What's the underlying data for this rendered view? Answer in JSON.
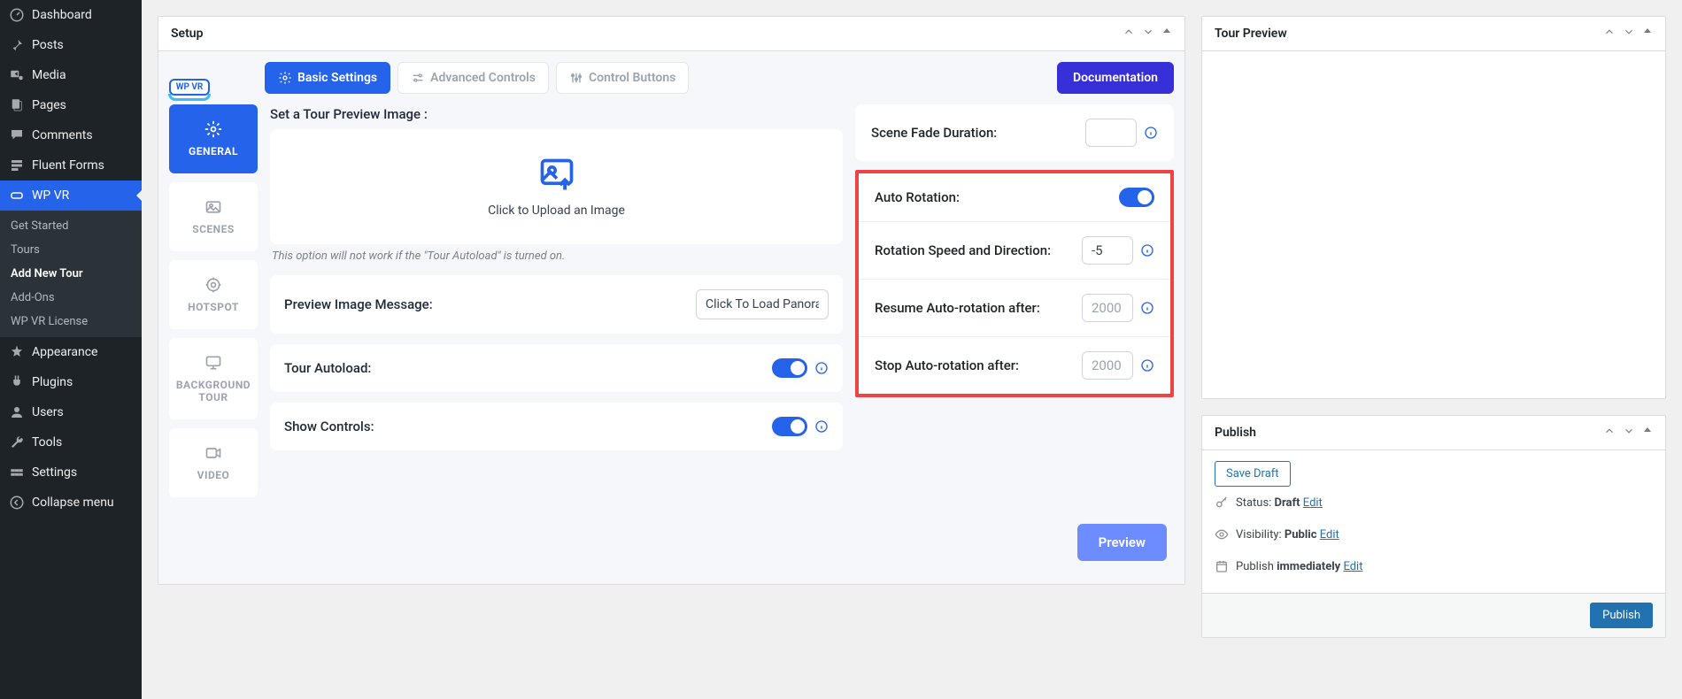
{
  "sidebar": {
    "items": [
      {
        "label": "Dashboard",
        "icon": "dashboard"
      },
      {
        "label": "Posts",
        "icon": "pin"
      },
      {
        "label": "Media",
        "icon": "media"
      },
      {
        "label": "Pages",
        "icon": "pages"
      },
      {
        "label": "Comments",
        "icon": "comments"
      },
      {
        "label": "Fluent Forms",
        "icon": "forms"
      },
      {
        "label": "WP VR",
        "icon": "wpvr",
        "active": true
      }
    ],
    "sub": [
      {
        "label": "Get Started"
      },
      {
        "label": "Tours"
      },
      {
        "label": "Add New Tour",
        "current": true
      },
      {
        "label": "Add-Ons"
      },
      {
        "label": "WP VR License"
      }
    ],
    "items2": [
      {
        "label": "Appearance",
        "icon": "appearance"
      },
      {
        "label": "Plugins",
        "icon": "plugins"
      },
      {
        "label": "Users",
        "icon": "users"
      },
      {
        "label": "Tools",
        "icon": "tools"
      },
      {
        "label": "Settings",
        "icon": "settings"
      },
      {
        "label": "Collapse menu",
        "icon": "collapse"
      }
    ]
  },
  "setup": {
    "title": "Setup",
    "logo": "WP VR",
    "tabs": {
      "basic": "Basic Settings",
      "advanced": "Advanced Controls",
      "control": "Control Buttons"
    },
    "doc_btn": "Documentation",
    "vtabs": {
      "general": "GENERAL",
      "scenes": "SCENES",
      "hotspot": "HOTSPOT",
      "bg": "BACKGROUND TOUR",
      "video": "VIDEO"
    },
    "preview_label": "Set a Tour Preview Image :",
    "upload_text": "Click to Upload an Image",
    "hint": "This option will not work if the \"Tour Autoload\" is turned on.",
    "msg_label": "Preview Image Message:",
    "msg_value": "Click To Load Panorama",
    "autoload_label": "Tour Autoload:",
    "show_controls_label": "Show Controls:",
    "fade_label": "Scene Fade Duration:",
    "auto_rot_label": "Auto Rotation:",
    "speed_label": "Rotation Speed and Direction:",
    "speed_value": "-5",
    "resume_label": "Resume Auto-rotation after:",
    "resume_placeholder": "2000",
    "stop_label": "Stop Auto-rotation after:",
    "stop_placeholder": "2000",
    "preview_btn": "Preview"
  },
  "tour_preview": {
    "title": "Tour Preview"
  },
  "publish": {
    "title": "Publish",
    "save_draft": "Save Draft",
    "status_label": "Status: ",
    "status_value": "Draft",
    "status_edit": "Edit",
    "vis_label": "Visibility: ",
    "vis_value": "Public",
    "vis_edit": "Edit",
    "sched_label": "Publish ",
    "sched_value": "immediately",
    "sched_edit": "Edit",
    "publish_btn": "Publish"
  }
}
